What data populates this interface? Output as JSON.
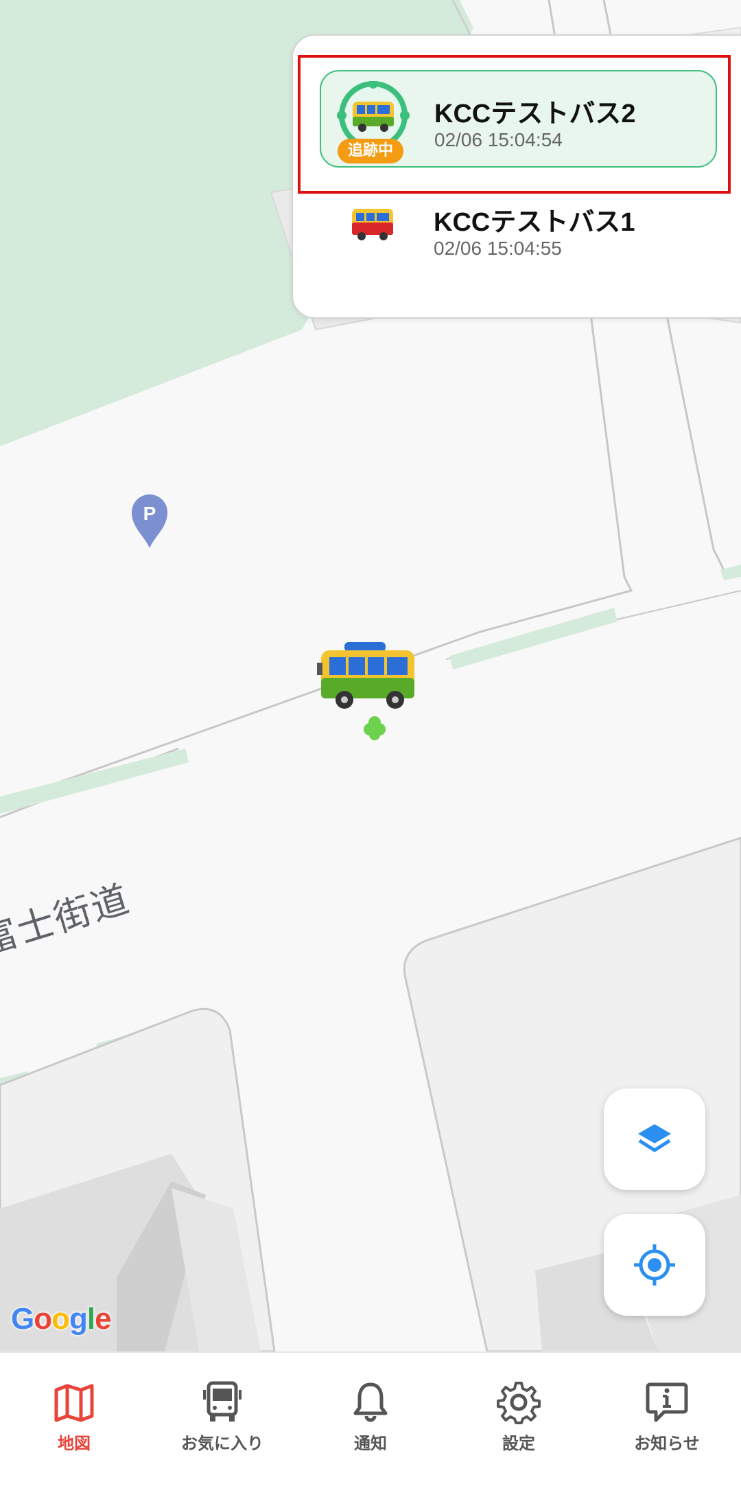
{
  "map": {
    "road_label": "富士街道",
    "google_logo": "Google",
    "google_colors": [
      "#4285F4",
      "#EA4335",
      "#FBBC05",
      "#4285F4",
      "#34A853",
      "#EA4335"
    ],
    "park_color": "#d4eadb",
    "building_color": "#e4e4e4",
    "parking_pin_letter": "P"
  },
  "bus_list": [
    {
      "name": "KCCテストバス2",
      "timestamp": "02/06 15:04:54",
      "badge": "追跡中",
      "tracking": true,
      "icon": "green-bus-icon"
    },
    {
      "name": "KCCテストバス1",
      "timestamp": "02/06 15:04:55",
      "tracking": false,
      "icon": "red-bus-icon"
    }
  ],
  "fabs": {
    "layers_icon": "layers-icon",
    "locate_icon": "my-location-icon",
    "accent": "#2b8ff2"
  },
  "tabs": [
    {
      "label": "地図",
      "icon": "map-icon",
      "active": true
    },
    {
      "label": "お気に入り",
      "icon": "bus-front-icon",
      "active": false
    },
    {
      "label": "通知",
      "icon": "bell-icon",
      "active": false
    },
    {
      "label": "設定",
      "icon": "gear-icon",
      "active": false
    },
    {
      "label": "お知らせ",
      "icon": "info-bubble-icon",
      "active": false
    }
  ],
  "colors": {
    "active_tab": "#e8443a",
    "inactive_tab": "#555555",
    "tracking_border": "#3cbf7c",
    "tracking_badge": "#f39c12",
    "highlight": "#e01010"
  }
}
